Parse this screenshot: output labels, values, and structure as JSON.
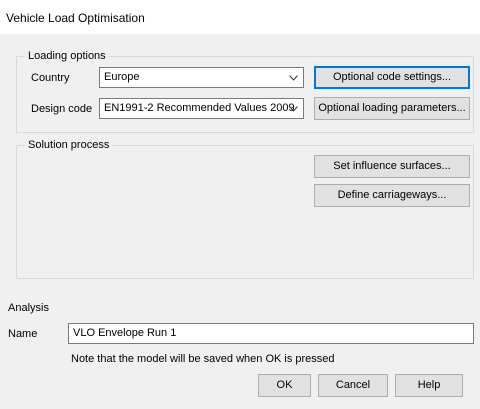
{
  "window": {
    "title": "Vehicle Load Optimisation"
  },
  "loading_options": {
    "legend": "Loading options",
    "country_label": "Country",
    "country_value": "Europe",
    "design_code_label": "Design code",
    "design_code_value": "EN1991-2 Recommended Values 2009",
    "optional_code_settings": "Optional code settings...",
    "optional_loading_parameters": "Optional loading parameters..."
  },
  "solution_process": {
    "legend": "Solution process",
    "set_influence_surfaces": "Set influence surfaces...",
    "define_carriageways": "Define carriageways..."
  },
  "analysis": {
    "heading": "Analysis",
    "name_label": "Name",
    "name_value": "VLO Envelope Run 1",
    "note": "Note that the model will be saved when OK is pressed"
  },
  "buttons": {
    "ok": "OK",
    "cancel": "Cancel",
    "help": "Help"
  },
  "colors": {
    "accent": "#0078d7",
    "dialog_bg": "#f0f0f0"
  }
}
